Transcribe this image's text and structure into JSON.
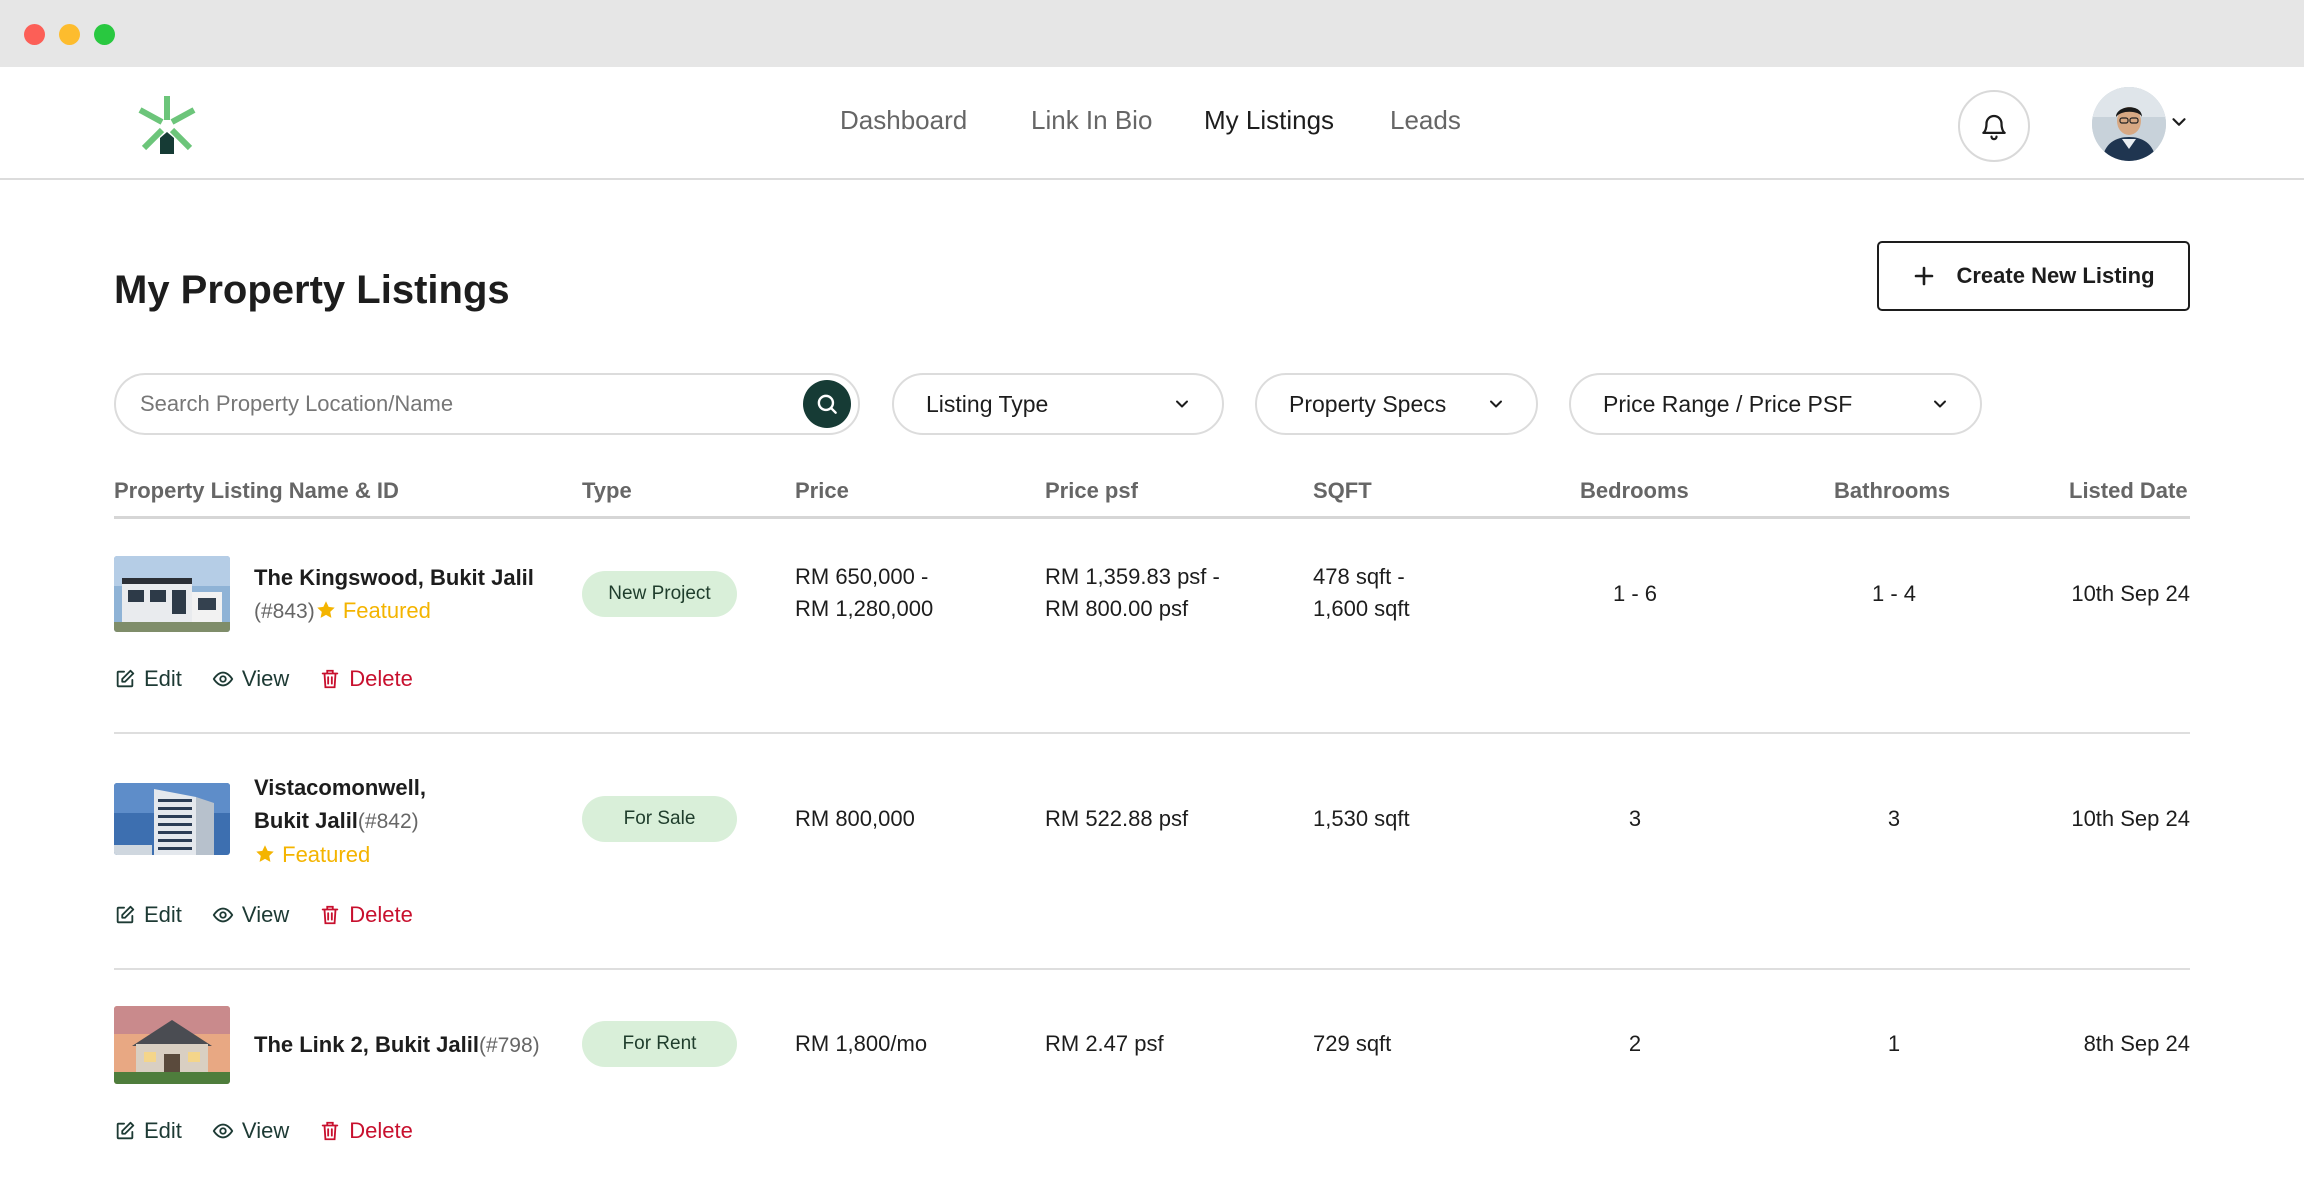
{
  "window": {
    "controls": [
      "close",
      "minimize",
      "maximize"
    ]
  },
  "nav": {
    "links": [
      {
        "label": "Dashboard",
        "active": false
      },
      {
        "label": "Link In Bio",
        "active": false
      },
      {
        "label": "My Listings",
        "active": true
      },
      {
        "label": "Leads",
        "active": false
      }
    ],
    "icons": {
      "logo": "asterisk-house-logo",
      "notifications": "bell-icon",
      "profile_menu": "chevron-down-icon"
    }
  },
  "page": {
    "title": "My Property Listings",
    "create_button": "Create New Listing"
  },
  "search": {
    "placeholder": "Search Property Location/Name"
  },
  "filters": {
    "listing_type": "Listing Type",
    "property_specs": "Property Specs",
    "price_range": "Price Range / Price PSF"
  },
  "table": {
    "headers": {
      "name": "Property Listing Name & ID",
      "type": "Type",
      "price": "Price",
      "price_psf": "Price psf",
      "sqft": "SQFT",
      "bedrooms": "Bedrooms",
      "bathrooms": "Bathrooms",
      "listed_date": "Listed Date"
    },
    "actions": {
      "edit": "Edit",
      "view": "View",
      "delete": "Delete"
    },
    "rows": [
      {
        "name_line1": "The Kingswood,  Bukit Jalil",
        "id": "(#843)",
        "featured": "Featured",
        "type": "New Project",
        "price_line1": "RM 650,000 -",
        "price_line2": "RM 1,280,000",
        "psf_line1": "RM 1,359.83 psf -",
        "psf_line2": "RM 800.00 psf",
        "sqft_line1": "478 sqft -",
        "sqft_line2": "1,600 sqft",
        "bedrooms": "1 - 6",
        "bathrooms": "1 - 4",
        "listed": "10th Sep 24"
      },
      {
        "name_line1": "Vistacomonwell,",
        "name_line2": "Bukit Jalil",
        "id": "(#842)",
        "featured": "Featured",
        "type": "For Sale",
        "price_line1": "RM 800,000",
        "psf_line1": "RM 522.88 psf",
        "sqft_line1": "1,530 sqft",
        "bedrooms": "3",
        "bathrooms": "3",
        "listed": "10th Sep 24"
      },
      {
        "name_line1": "The Link 2,  Bukit Jalil",
        "id": "(#798)",
        "type": "For Rent",
        "price_line1": "RM 1,800/mo",
        "psf_line1": "RM 2.47 psf",
        "sqft_line1": "729 sqft",
        "bedrooms": "2",
        "bathrooms": "1",
        "listed": "8th Sep 24"
      }
    ]
  },
  "colors": {
    "brand_green": "#6cc57a",
    "dark_green": "#163b35",
    "badge_bg": "#d9efd9",
    "featured": "#f4b400",
    "delete": "#c8102e"
  }
}
